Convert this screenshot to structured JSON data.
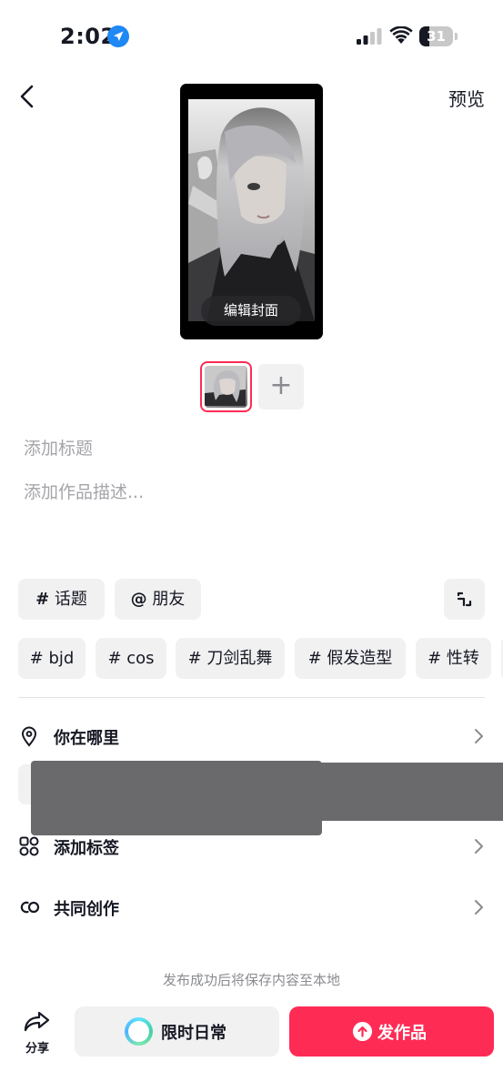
{
  "status_bar": {
    "time": "2:02",
    "battery_level": "31",
    "battery_fraction": 0.31
  },
  "header": {
    "back_icon": "chevron-left-icon",
    "preview_label": "预览"
  },
  "cover": {
    "edit_label": "编辑封面"
  },
  "thumbnails": {
    "add_icon": "plus-icon",
    "add_label": "+"
  },
  "inputs": {
    "title_placeholder": "添加标题",
    "description_placeholder": "添加作品描述..."
  },
  "actions": {
    "topic": {
      "hash": "#",
      "label": "话题"
    },
    "friend": {
      "at": "@",
      "label": "朋友"
    },
    "expand_icon": "expand-icon"
  },
  "suggested_tags": [
    {
      "hash": "#",
      "label": "bjd"
    },
    {
      "hash": "#",
      "label": "cos"
    },
    {
      "hash": "#",
      "label": "刀剑乱舞"
    },
    {
      "hash": "#",
      "label": "假发造型"
    },
    {
      "hash": "#",
      "label": "性转"
    }
  ],
  "options": [
    {
      "icon": "location-pin-icon",
      "label": "你在哪里"
    },
    {
      "icon": "tag-grid-icon",
      "label": "添加标签"
    },
    {
      "icon": "co-create-icon",
      "label": "共同创作"
    }
  ],
  "footer": {
    "save_notice": "发布成功后将保存内容至本地",
    "share_label": "分享",
    "daily_label": "限时日常",
    "publish_label": "发作品"
  },
  "colors": {
    "accent": "#fe2c55",
    "chip_bg": "#f1f1f2",
    "placeholder": "#a4a5aa"
  }
}
